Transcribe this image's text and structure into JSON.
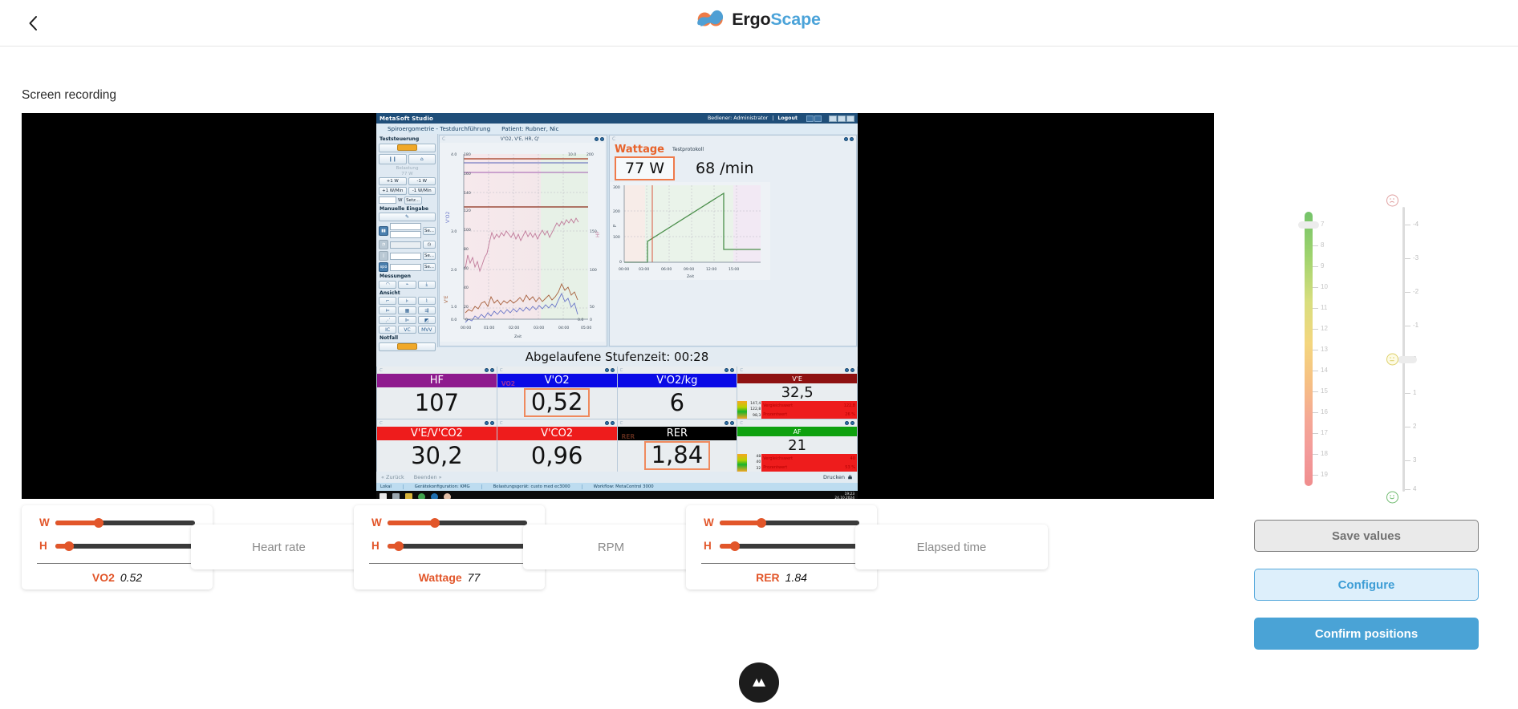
{
  "header": {
    "back_icon": "chevron-left-icon",
    "brand_primary": "Ergo",
    "brand_secondary": "Scape",
    "logo_icon": "ergoscape-infinity-logo"
  },
  "main": {
    "section_label": "Screen recording"
  },
  "recording": {
    "window": {
      "title": "MetaSoft Studio",
      "operator_label": "Bediener: Administrator",
      "logout_label": "Logout",
      "menu": [
        "Spiroergometrie - Testdurchführung",
        "Patient:  Rubner, Nic"
      ],
      "left_panel": {
        "group1_title": "Teststeuerung",
        "pause_icon": "pause-icon",
        "bell_icon": "bell-icon",
        "load_label": "Belastung",
        "load_value": "77 W",
        "buttons": [
          "+1 W",
          "-1 W",
          "+1 W/Min",
          "-1 W/Min"
        ],
        "w_unit": "W",
        "set_label": "Setz...",
        "group2_title": "Manuelle Eingabe",
        "se_label": "Se...",
        "group3_title": "Messungen",
        "group4_title": "Ansicht",
        "group5_title": "Notfall"
      },
      "chart_left": {
        "title": "V'O2, V'E, HR, Q'",
        "y_left_top": "4.0",
        "y_left_mid": "3.0",
        "y_left_label_1": "V'O2",
        "y_left_label_2": "V'E",
        "y_right_top": "10.0",
        "axis_x_label": "Zeit",
        "x_ticks": [
          "00:00",
          "01:00",
          "02:00",
          "03:00",
          "04:00",
          "05:00"
        ],
        "y_ticks_inner": [
          "180",
          "160",
          "140",
          "120",
          "100",
          "80",
          "60",
          "40",
          "20",
          "0"
        ],
        "y_ticks_right": [
          "200",
          "150",
          "100",
          "50",
          "0"
        ]
      },
      "chart_right": {
        "wattage_label": "Wattage",
        "protocol_label": "Testprotokoll",
        "wattage_value": "77 W",
        "rpm_value": "68 /min",
        "y_ticks": [
          "300",
          "200",
          "100",
          "0"
        ],
        "x_ticks": [
          "00:00",
          "03:00",
          "06:00",
          "09:00",
          "12:00",
          "15:00"
        ],
        "axis_x_label": "Zeit"
      },
      "elapsed_text": "Abgelaufene Stufenzeit: 00:28",
      "tiles": [
        {
          "name": "HF",
          "value": "107",
          "header_color": "#8e1a8e",
          "boxed": false,
          "sub": ""
        },
        {
          "name": "V'O2",
          "value": "0,52",
          "header_color": "#0a0ae6",
          "boxed": true,
          "sub": "VO2"
        },
        {
          "name": "V'O2/kg",
          "value": "6",
          "header_color": "#0a0ae6",
          "boxed": false,
          "sub": ""
        },
        {
          "name": "V'E",
          "value": "32,5",
          "header_color": "#8e1111",
          "boxed": false,
          "sub": "",
          "mini": {
            "nums": [
              "147,4",
              "122,8",
              "98,3"
            ],
            "rows": [
              [
                "Vergleichswert",
                "122,8"
              ],
              [
                "Prozentwert",
                "26 %"
              ]
            ]
          }
        },
        {
          "name": "V'E/V'CO2",
          "value": "30,2",
          "header_color": "#ee1c1c",
          "boxed": false,
          "sub": ""
        },
        {
          "name": "V'CO2",
          "value": "0,96",
          "header_color": "#ee1c1c",
          "boxed": false,
          "sub": ""
        },
        {
          "name": "RER",
          "value": "1,84",
          "header_color": "#000000",
          "boxed": true,
          "sub": "RER"
        },
        {
          "name": "AF",
          "value": "21",
          "header_color": "#0fa10f",
          "boxed": false,
          "sub": "",
          "mini": {
            "nums": [
              "48",
              "40",
              "32"
            ],
            "rows": [
              [
                "Vergleichswert",
                "40"
              ],
              [
                "Prozentwert",
                "53 %"
              ]
            ]
          }
        }
      ],
      "footer": {
        "back": "« Zurück",
        "finish": "Beenden »",
        "print": "Drucken",
        "print_icon": "printer-icon",
        "status": [
          "Lokal",
          "Gerätekonfiguration: KMG",
          "Belastungsgerät: custo med ec3000",
          "Workflow: MetaControl 3000"
        ],
        "clock_time": "19:23",
        "clock_date": "24.10.2024"
      }
    }
  },
  "metric_cards": [
    {
      "type": "slider",
      "w_label": "W",
      "h_label": "H",
      "w_percent": 31,
      "h_percent": 10,
      "metric": "VO2",
      "value": "0.52"
    },
    {
      "type": "placeholder",
      "label": "Heart rate"
    },
    {
      "type": "slider",
      "w_label": "W",
      "h_label": "H",
      "w_percent": 34,
      "h_percent": 8,
      "metric": "Wattage",
      "value": "77"
    },
    {
      "type": "placeholder",
      "label": "RPM"
    },
    {
      "type": "slider",
      "w_label": "W",
      "h_label": "H",
      "w_percent": 30,
      "h_percent": 11,
      "metric": "RER",
      "value": "1.84"
    },
    {
      "type": "placeholder",
      "label": "Elapsed time"
    }
  ],
  "scales": {
    "borg": {
      "name": "borg-scale",
      "ticks": [
        "7",
        "8",
        "9",
        "10",
        "11",
        "12",
        "13",
        "14",
        "15",
        "16",
        "17",
        "18",
        "19"
      ],
      "selected": "7",
      "gradient_from": "#74c36a",
      "gradient_to": "#f08d8d"
    },
    "rpe": {
      "name": "comfort-scale",
      "ticks": [
        "-4",
        "-3",
        "-2",
        "-1",
        "0",
        "1",
        "2",
        "3",
        "4"
      ],
      "selected": "0",
      "top_face": "sad-face-icon",
      "mid_face": "neutral-face-icon",
      "bottom_face": "happy-face-icon"
    }
  },
  "actions": {
    "save": "Save values",
    "configure": "Configure",
    "confirm": "Confirm positions"
  },
  "fab": {
    "icon": "app-mountain-icon"
  },
  "colors": {
    "accent_orange": "#e2562a",
    "accent_blue": "#4aa3d6",
    "brand_blue": "#4ba3d9"
  }
}
